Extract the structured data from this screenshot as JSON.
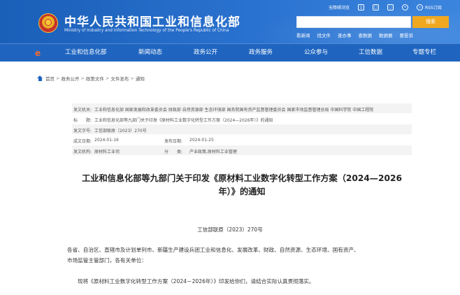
{
  "header": {
    "title_cn": "中华人民共和国工业和信息化部",
    "title_en": "Ministry of Industry and Information Technology of the People's Republic of China",
    "util": {
      "accessible": "无障碍浏览",
      "rss": "RSS订阅"
    },
    "search": {
      "placeholder": "",
      "button": "搜索"
    },
    "quick_links": [
      "看新闻",
      "找文件",
      "查办事",
      "查数据",
      "数据据",
      "要投诉"
    ]
  },
  "nav": {
    "items": [
      "工业和信息化部",
      "新闻动态",
      "政务公开",
      "政务服务",
      "公众参与",
      "工信数据",
      "专题专栏"
    ]
  },
  "breadcrumb": [
    "首页",
    "政务公开",
    "政策文件",
    "文件发布",
    "通知"
  ],
  "meta": {
    "rows": [
      {
        "label": "发文机关:",
        "value": "工业和信息化部 国家发展和改革委员会 财政部 自然资源部 生态环境部 国务院国有资产监督管理委员会 国家市场监督管理总局 中国科学院 中国工程院"
      },
      {
        "label": "标　　题:",
        "value": "工业和信息化部等九部门关于印发《原材料工业数字化转型工作方案（2024—2026年）》的通知"
      },
      {
        "label": "发文字号:",
        "value": "工信部联原（2023）270号"
      },
      {
        "label": "成文日期:",
        "value": "2024-01-16",
        "label2": "发布日期:",
        "value2": "2024-01-25"
      },
      {
        "label": "发文机构:",
        "value": "原材料工业司",
        "label2": "分　　类:",
        "value2": "产业政策,原材料工业管理"
      }
    ]
  },
  "article": {
    "title_line1": "工业和信息化部等九部门关于印发《原材料工业数字化转型工作方案（2024—2026",
    "title_line2": "年）》的通知",
    "doc_number": "工信部联原（2023）270号",
    "para1_line1": "各省、自治区、直辖市及计划单列市、新疆生产建设兵团工业和信息化、发展改革、财政、自然资源、生态环境、国有资产、",
    "para1_line2": "市场监管主管部门，各有关单位：",
    "para2": "现将《原材料工业数字化转型工作方案（2024－2026年）》印发给你们，请结合实际认真贯彻落实。"
  },
  "colors": {
    "header_blue": "#1a5fb8",
    "nav_blue": "#1f65c0",
    "search_button": "#f0a820"
  }
}
